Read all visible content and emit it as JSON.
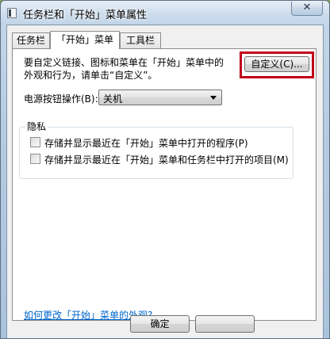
{
  "window": {
    "title": "任务栏和「开始」菜单属性",
    "close_label": "✕"
  },
  "tabs": [
    {
      "label": "任务栏",
      "active": false
    },
    {
      "label": "「开始」菜单",
      "active": true
    },
    {
      "label": "工具栏",
      "active": false
    }
  ],
  "start_menu": {
    "description_line1": "要自定义链接、图标和菜单在「开始」菜单中的",
    "description_line2": "外观和行为，请单击“自定义”。",
    "customize_button": "自定义(C)...",
    "power_label": "电源按钮操作(B):",
    "power_value": "关机",
    "privacy_group": "隐私",
    "privacy_options": [
      {
        "label": "存储并显示最近在「开始」菜单中打开的程序(P)",
        "checked": false
      },
      {
        "label": "存储并显示最近在「开始」菜单和任务栏中打开的项目(M)",
        "checked": false
      }
    ],
    "appearance_link": "如何更改「开始」菜单的外观?"
  },
  "footer": {
    "ok_button": "确定"
  },
  "colors": {
    "highlight_box": "#c0001a",
    "link": "#0066cc"
  }
}
